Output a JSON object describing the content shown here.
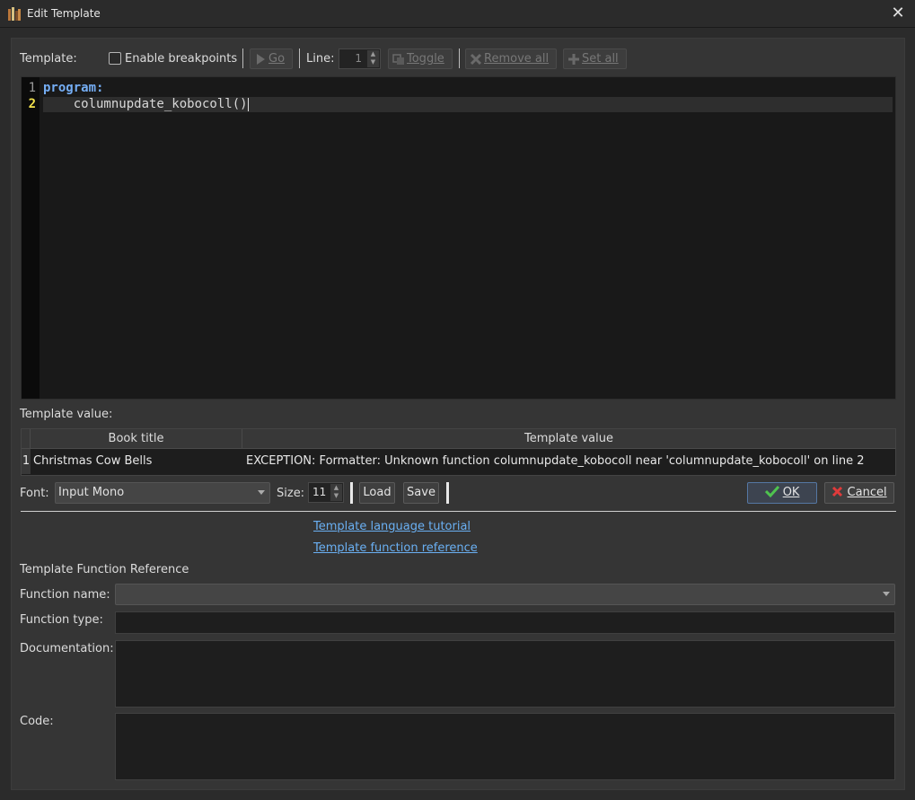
{
  "window": {
    "title": "Edit Template",
    "close_glyph": "✕",
    "app_icon": "calibre-books-icon"
  },
  "toolbar": {
    "template_label": "Template:",
    "breakpoints_label": "Enable breakpoints",
    "breakpoints_checked": false,
    "go_label": "Go",
    "line_label": "Line:",
    "line_value": "1",
    "toggle_label": "Toggle",
    "remove_all_label": "Remove all",
    "set_all_label": "Set all"
  },
  "editor": {
    "line_numbers": [
      "1",
      "2"
    ],
    "lines": [
      {
        "keyword": "program",
        "punct": ":"
      },
      {
        "indent": "    ",
        "text": "columnupdate_kobocoll()"
      }
    ]
  },
  "results": {
    "label": "Template value:",
    "columns": [
      "Book title",
      "Template value"
    ],
    "rows": [
      {
        "index": "1",
        "book_title": "Christmas Cow Bells",
        "value": "EXCEPTION:  Formatter: Unknown function columnupdate_kobocoll near 'columnupdate_kobocoll' on line 2"
      }
    ]
  },
  "font_row": {
    "font_label": "Font:",
    "font_value": "Input Mono",
    "size_label": "Size:",
    "size_value": "11",
    "load_label": "Load",
    "save_label": "Save",
    "ok_label": "OK",
    "cancel_label": "Cancel"
  },
  "links": {
    "tutorial": "Template language tutorial",
    "reference": "Template function reference"
  },
  "function_ref": {
    "heading": "Template Function Reference",
    "name_label": "Function name:",
    "name_value": "",
    "type_label": "Function type:",
    "doc_label": "Documentation:",
    "code_label": "Code:"
  },
  "colors": {
    "accent": "#6ab0f3",
    "keyword": "#75aef5",
    "ok_check": "#4fc34f",
    "cancel_x": "#e03b3b",
    "active_line_number": "#f2e14c"
  }
}
